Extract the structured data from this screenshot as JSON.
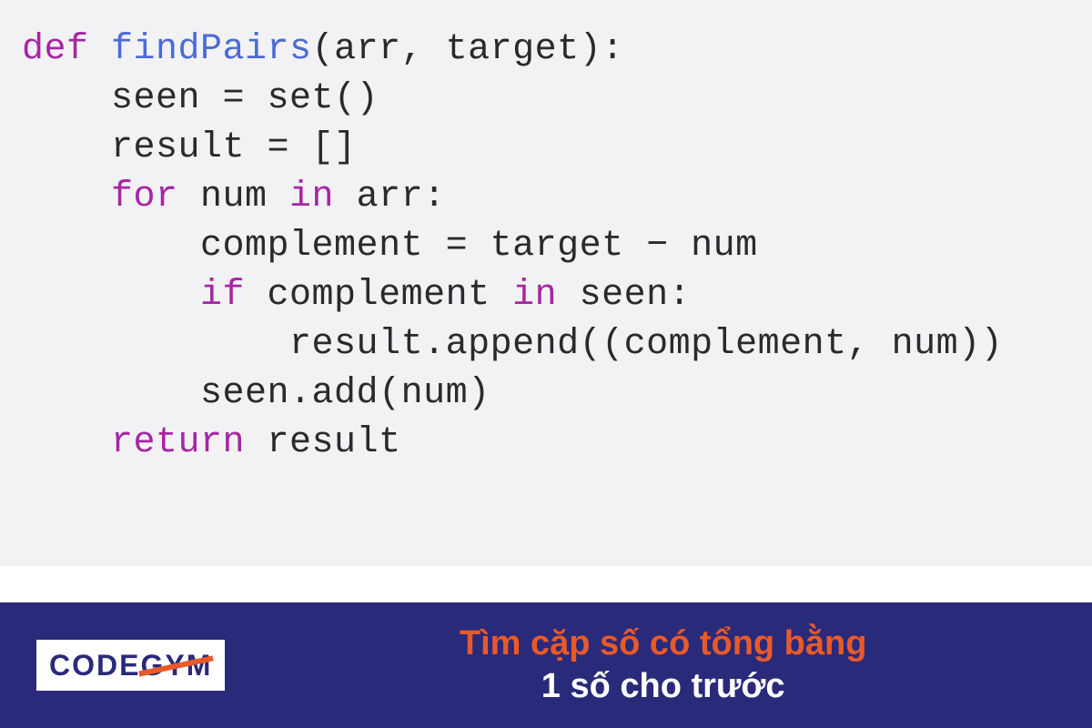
{
  "code": {
    "line1_def": "def ",
    "line1_fn": "findPairs",
    "line1_rest": "(arr, target):",
    "line2": "    seen = set()",
    "line3": "    result = []",
    "line4": "",
    "line5_pre": "    ",
    "line5_for": "for ",
    "line5_mid": "num ",
    "line5_in": "in ",
    "line5_rest": "arr:",
    "line6": "        complement = target − num",
    "line7_pre": "        ",
    "line7_if": "if ",
    "line7_mid": "complement ",
    "line7_in": "in ",
    "line7_rest": "seen:",
    "line8": "            result.append((complement, num))",
    "line9": "        seen.add(num)",
    "line10": "",
    "line11_pre": "    ",
    "line11_return": "return ",
    "line11_rest": "result"
  },
  "footer": {
    "logo_left": "CODE",
    "logo_right": "GYM",
    "caption_line1": "Tìm cặp số có tổng bằng",
    "caption_line2": "1 số cho trước"
  }
}
